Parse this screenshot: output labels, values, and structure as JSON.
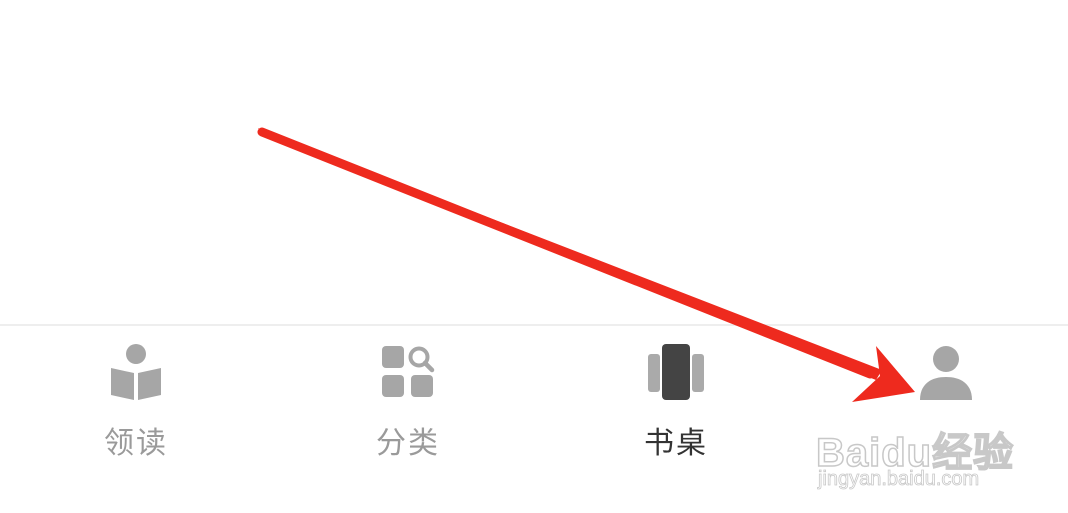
{
  "tabbar": {
    "items": [
      {
        "label": "领读",
        "icon": "reading-book-icon",
        "active": false
      },
      {
        "label": "分类",
        "icon": "category-grid-search-icon",
        "active": false
      },
      {
        "label": "书桌",
        "icon": "bookshelf-cards-icon",
        "active": true
      },
      {
        "label": "",
        "icon": "person-icon",
        "active": false
      }
    ]
  },
  "annotation": {
    "arrow_color": "#ee2a1e"
  },
  "watermark": {
    "brand": "Baidu经验",
    "url": "jingyan.baidu.com"
  },
  "colors": {
    "inactive": "#9a9a9a",
    "active": "#333333",
    "icon_inactive": "#a6a6a6",
    "icon_active": "#444444",
    "divider": "#eeeeee"
  }
}
